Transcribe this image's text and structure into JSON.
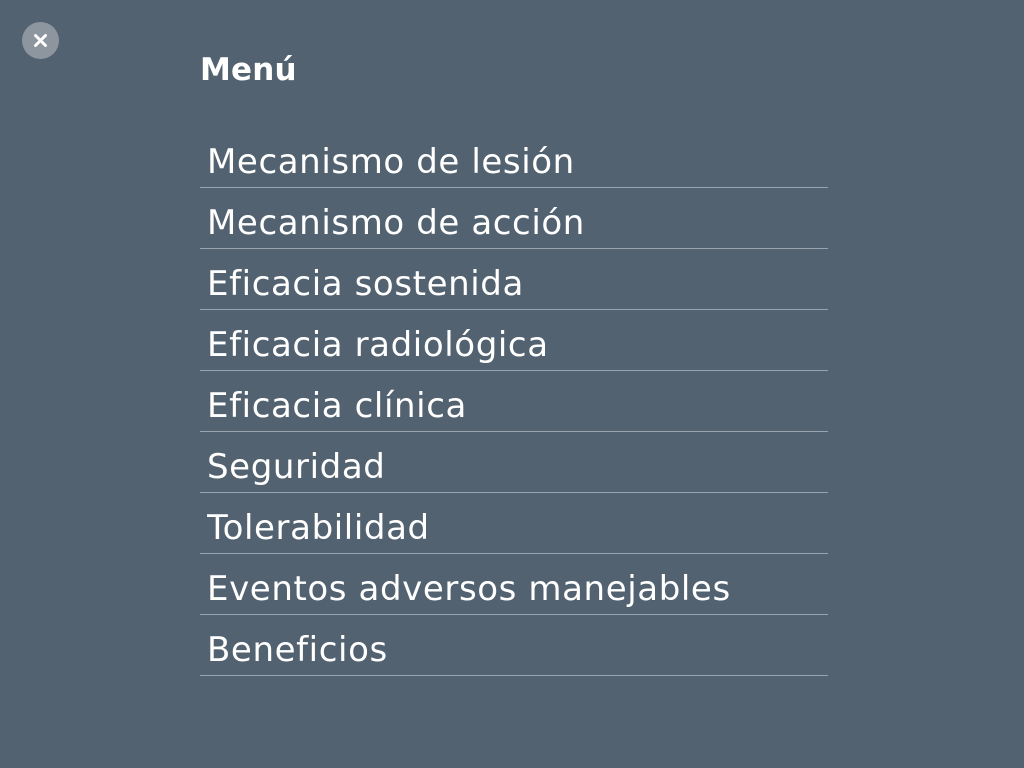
{
  "close": {
    "icon": "close-icon"
  },
  "header": {
    "title": "Menú"
  },
  "menu": {
    "items": [
      {
        "label": "Mecanismo de lesión"
      },
      {
        "label": "Mecanismo de acción"
      },
      {
        "label": "Eficacia sostenida"
      },
      {
        "label": "Eficacia radiológica"
      },
      {
        "label": "Eficacia clínica"
      },
      {
        "label": "Seguridad"
      },
      {
        "label": "Tolerabilidad"
      },
      {
        "label": "Eventos adversos manejables"
      },
      {
        "label": "Beneficios"
      }
    ]
  },
  "colors": {
    "background": "#536270",
    "close_button": "#8d959f",
    "divider": "#9aa4ae",
    "text": "#ffffff"
  }
}
